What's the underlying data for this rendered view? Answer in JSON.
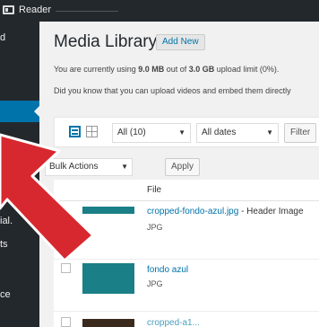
{
  "topbar": {
    "reader_label": "Reader"
  },
  "sidebar": {
    "items": [
      {
        "label": "d"
      },
      {
        "label": "ial."
      },
      {
        "label": "ts"
      },
      {
        "label": "ce"
      }
    ]
  },
  "header": {
    "title": "Media Library",
    "add_new": "Add New"
  },
  "notices": {
    "usage_prefix": "You are currently using ",
    "usage_used": "9.0 MB",
    "usage_middle": " out of ",
    "usage_limit": "3.0 GB",
    "usage_suffix": " upload limit (0%).",
    "upload_tip": "Did you know that you can upload videos and embed them directly"
  },
  "filters": {
    "type_selected": "All (10)",
    "date_selected": "All dates",
    "filter_label": "Filter"
  },
  "bulk": {
    "selected": "Bulk Actions",
    "apply_label": "Apply"
  },
  "table": {
    "columns": {
      "file": "File"
    },
    "rows": [
      {
        "title": "cropped-fondo-azul.jpg",
        "suffix": " - Header Image",
        "type": "JPG"
      },
      {
        "title": "fondo azul",
        "suffix": "",
        "type": "JPG"
      },
      {
        "title": "cropped-a1...",
        "suffix": "",
        "type": ""
      }
    ]
  },
  "colors": {
    "accent": "#0073aa",
    "sidebar_bg": "#23282d",
    "arrow_red": "#d7282f",
    "thumb_teal": "#1a7f86"
  }
}
